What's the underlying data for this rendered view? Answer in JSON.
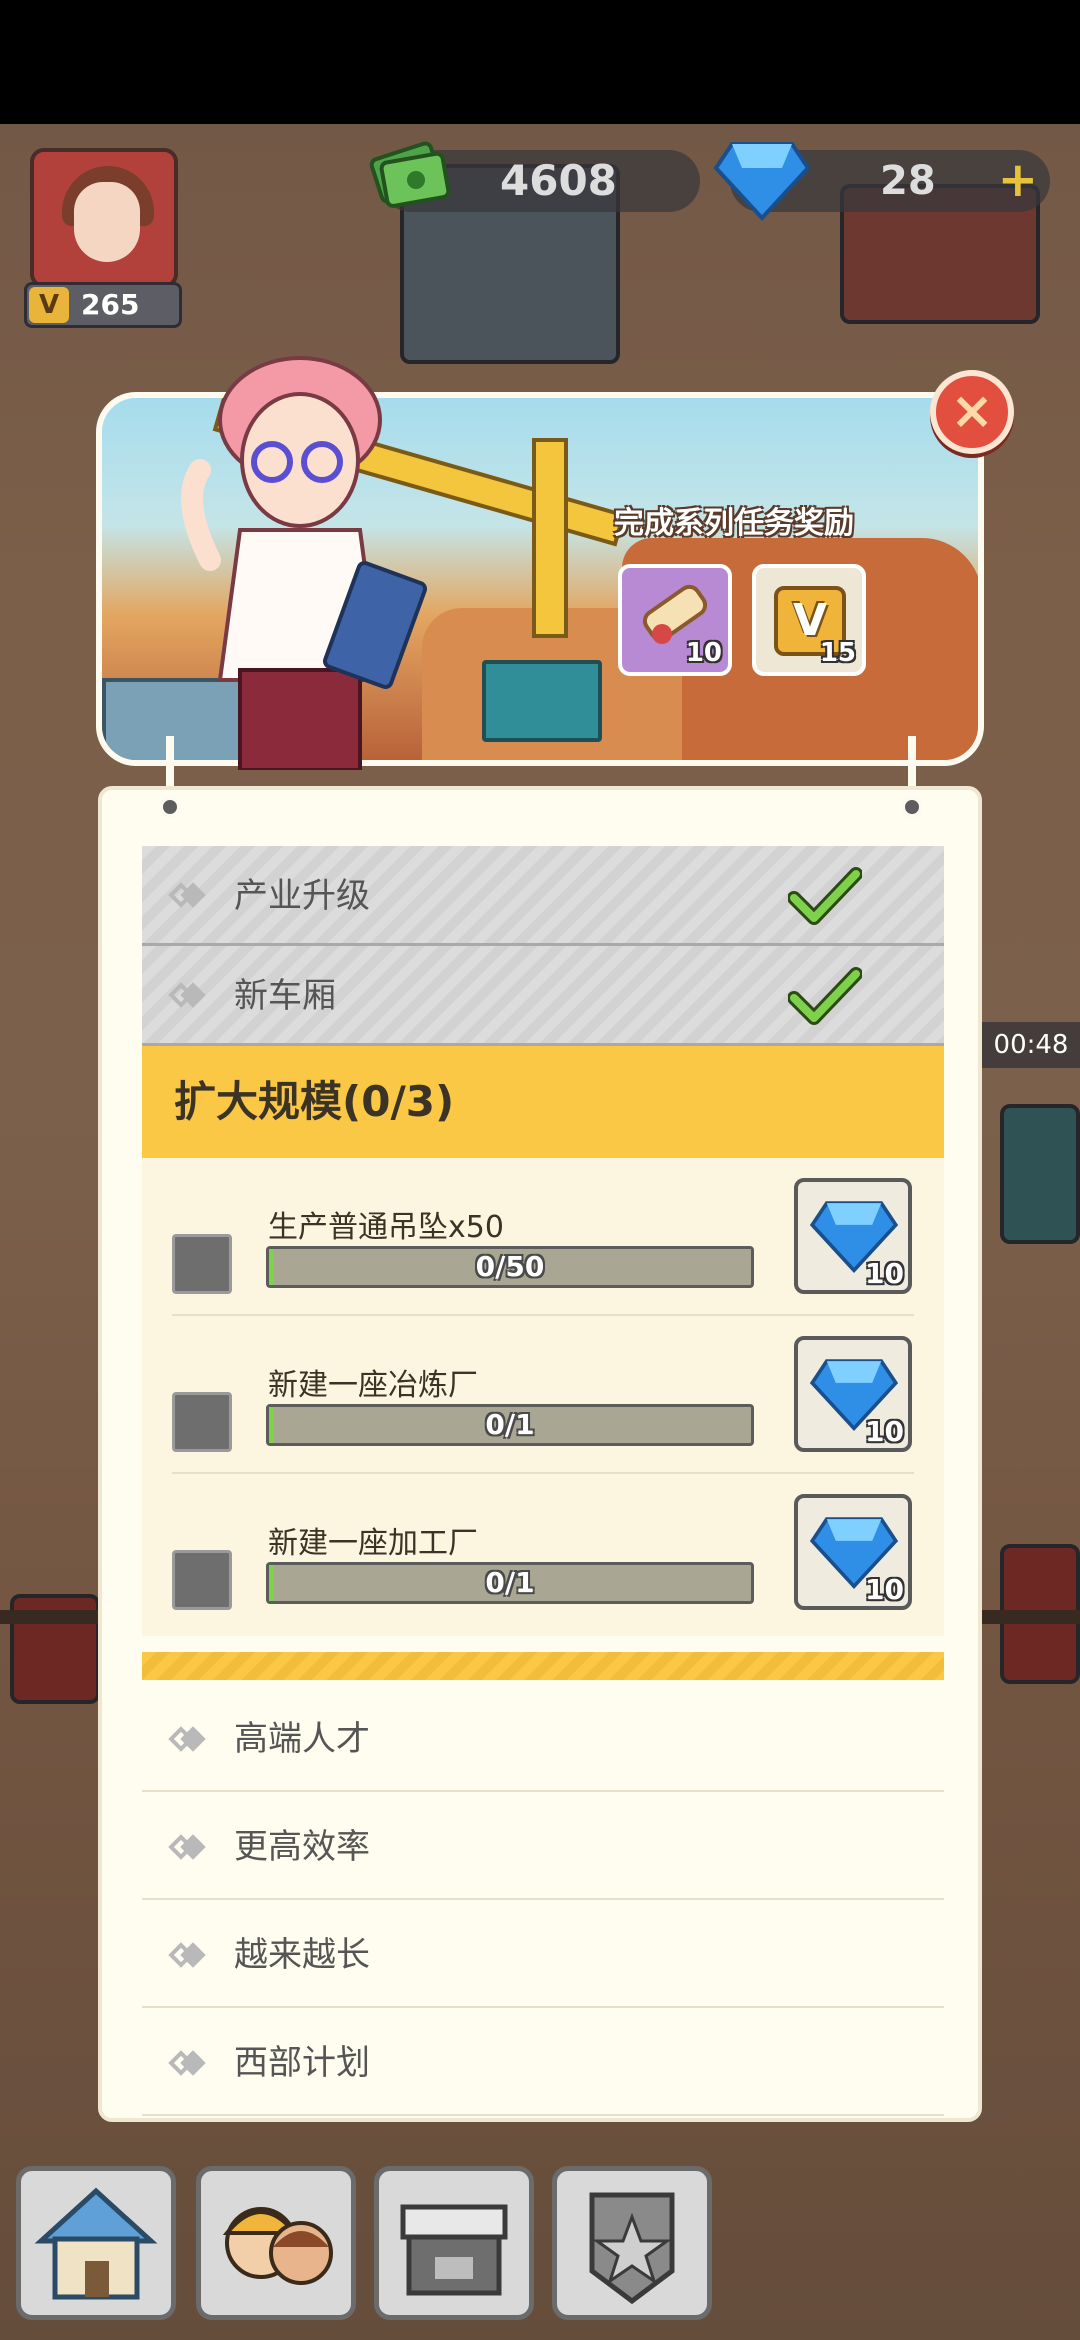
{
  "hud": {
    "vip_badge": "V",
    "vip_level": "265",
    "cash": "4608",
    "gems": "28",
    "plus": "+",
    "timer": "00:48"
  },
  "banner": {
    "reward_title": "完成系列任务奖励",
    "rewards": [
      {
        "icon": "scroll-icon",
        "count": "10"
      },
      {
        "icon": "vip-icon",
        "label": "V",
        "count": "15"
      }
    ],
    "close": "×"
  },
  "panel": {
    "completed": [
      {
        "label": "产业升级"
      },
      {
        "label": "新车厢"
      }
    ],
    "current_section": {
      "title": "扩大规模",
      "progress": "0/3",
      "tasks": [
        {
          "name": "生产普通吊坠x50",
          "progress_text": "0/50",
          "progress": 0,
          "reward": "10"
        },
        {
          "name": "新建一座冶炼厂",
          "progress_text": "0/1",
          "progress": 0,
          "reward": "10"
        },
        {
          "name": "新建一座加工厂",
          "progress_text": "0/1",
          "progress": 0,
          "reward": "10"
        }
      ]
    },
    "locked": [
      {
        "label": "高端人才"
      },
      {
        "label": "更高效率"
      },
      {
        "label": "越来越长"
      },
      {
        "label": "西部计划"
      }
    ]
  },
  "colors": {
    "section_yellow": "#fbc845",
    "check_green": "#7ed14a",
    "close_red": "#e34f3e",
    "gem_blue": "#2f8fe6"
  }
}
